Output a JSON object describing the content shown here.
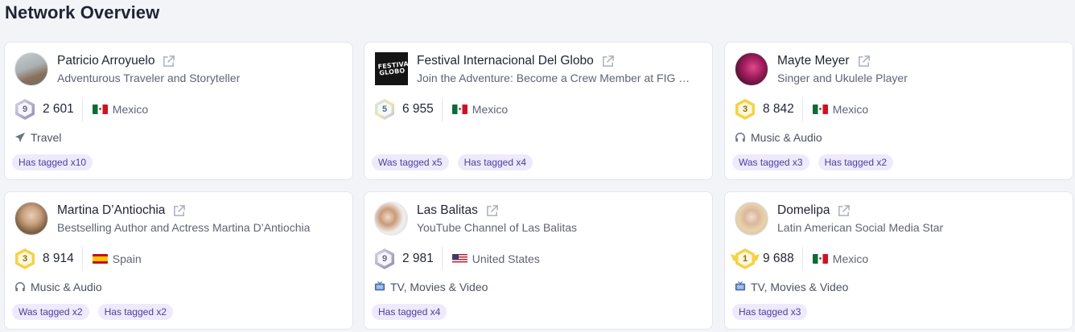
{
  "page": {
    "title": "Network Overview"
  },
  "cards": [
    {
      "name": "Patricio Arroyuelo",
      "subtitle": "Adventurous Traveler and Storyteller",
      "level": "9",
      "followers": "2 601",
      "country": "Mexico",
      "category": "Travel",
      "category_icon": "airplane-icon",
      "tags": [
        "Has tagged x10"
      ]
    },
    {
      "name": "Festival Internacional Del Globo",
      "subtitle": "Join the Adventure: Become a Crew Member at FIG …",
      "avatar_text": "FESTIVAL GLOBO",
      "level": "5",
      "followers": "6 955",
      "country": "Mexico",
      "category": "",
      "category_icon": "",
      "tags": [
        "Was tagged x5",
        "Has tagged x4"
      ]
    },
    {
      "name": "Mayte Meyer",
      "subtitle": "Singer and Ukulele Player",
      "level": "3",
      "followers": "8 842",
      "country": "Mexico",
      "category": "Music & Audio",
      "category_icon": "headphones-icon",
      "tags": [
        "Was tagged x3",
        "Has tagged x2"
      ]
    },
    {
      "name": "Martina D’Antiochia",
      "subtitle": "Bestselling Author and Actress Martina D’Antiochia",
      "level": "3",
      "followers": "8 914",
      "country": "Spain",
      "category": "Music & Audio",
      "category_icon": "headphones-icon",
      "tags": [
        "Was tagged x2",
        "Has tagged x2"
      ]
    },
    {
      "name": "Las Balitas",
      "subtitle": "YouTube Channel of Las Balitas",
      "level": "9",
      "followers": "2 981",
      "country": "United States",
      "category": "TV, Movies & Video",
      "category_icon": "tv-icon",
      "tags": [
        "Has tagged x4"
      ]
    },
    {
      "name": "Domelipa",
      "subtitle": "Latin American Social Media Star",
      "level": "1",
      "followers": "9 688",
      "country": "Mexico",
      "category": "TV, Movies & Video",
      "category_icon": "tv-icon",
      "tags": [
        "Has tagged x3"
      ]
    }
  ],
  "colors": {
    "background": "#f2f4f8",
    "tag_bg": "#eeeafc",
    "tag_text": "#4b3e9c",
    "gold": "#f4d24a",
    "silver": "#9e9ab8"
  }
}
